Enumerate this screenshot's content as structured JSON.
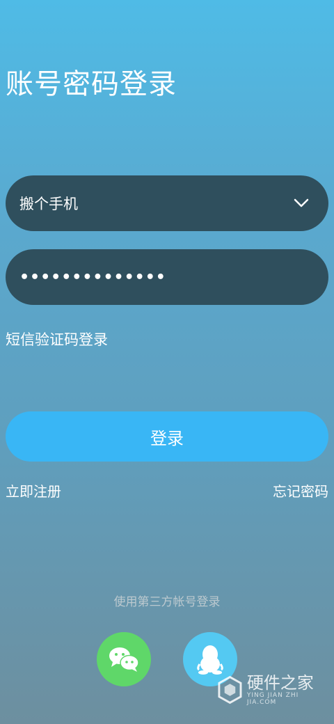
{
  "page": {
    "title": "账号密码登录"
  },
  "form": {
    "account_value": "搬个手机",
    "password_masked": "••••••••••••••",
    "sms_login_link": "短信验证码登录",
    "login_button": "登录",
    "register_link": "立即注册",
    "forgot_link": "忘记密码"
  },
  "third_party": {
    "label": "使用第三方帐号登录",
    "options": [
      "wechat",
      "qq"
    ]
  },
  "watermark": {
    "main": "硬件之家",
    "sub": "YING JIAN ZHI JIA.COM"
  },
  "colors": {
    "field_bg": "#2f4f5d",
    "login_button": "#39b6f5",
    "wechat": "#5fd769",
    "qq": "#54c9f2"
  }
}
